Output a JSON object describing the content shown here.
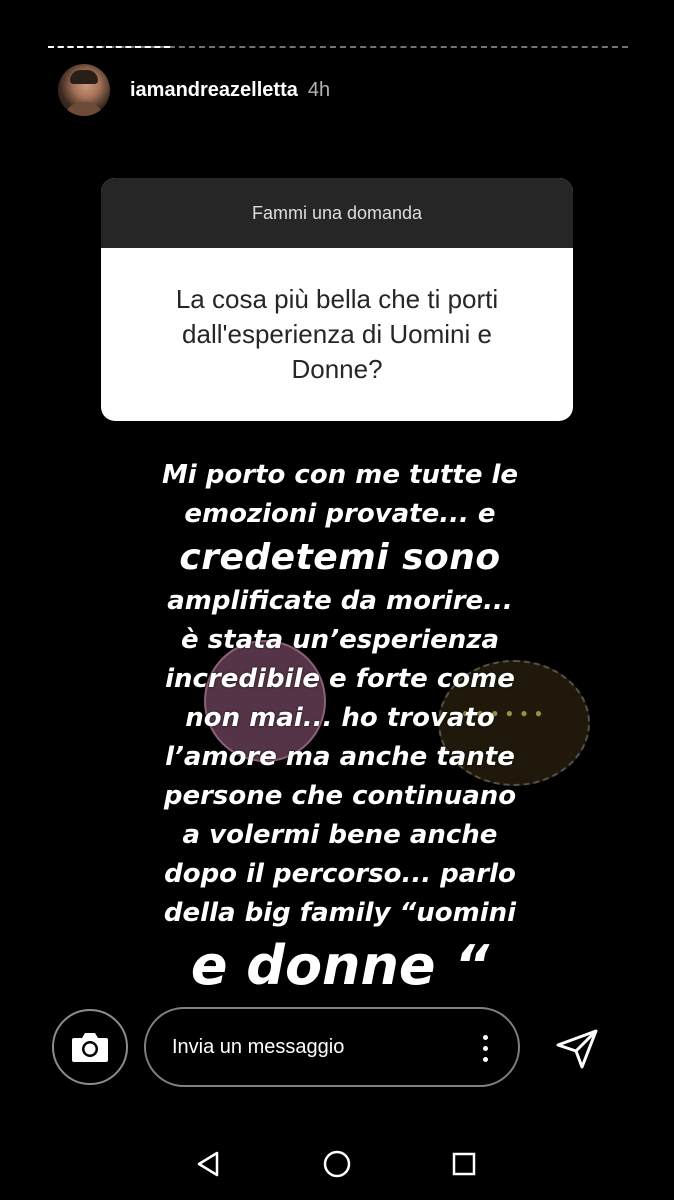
{
  "story": {
    "username": "iamandreazelletta",
    "time": "4h",
    "progress": 0.21
  },
  "question_card": {
    "title": "Fammi una domanda",
    "text": "La cosa più bella che ti porti dall'esperienza di Uomini e Donne?"
  },
  "answer": {
    "lines": [
      "Mi porto con me tutte le",
      "emozioni provate... e",
      "credetemi sono",
      "amplificate da morire...",
      "è stata un’esperienza",
      "incredibile e forte come",
      "non mai... ho trovato",
      "l’amore ma anche tante",
      "persone che continuano",
      "a volermi bene anche",
      "dopo il percorso... parlo",
      "della big family “uomini",
      "e donne “"
    ]
  },
  "reply_bar": {
    "placeholder": "Invia un messaggio",
    "camera_icon": "camera-icon",
    "more_icon": "more-vertical-icon",
    "send_icon": "send-icon"
  },
  "nav": {
    "back_icon": "back-icon",
    "home_icon": "home-icon",
    "recents_icon": "recents-icon"
  },
  "colors": {
    "background": "#000000",
    "card_header": "#262626",
    "card_body": "#ffffff"
  }
}
